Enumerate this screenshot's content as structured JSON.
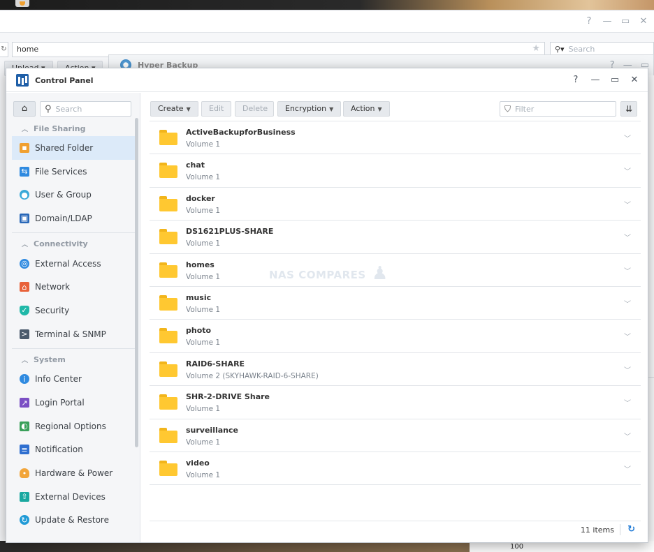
{
  "colors": {
    "accent": "#1f7ad6",
    "active_item_bg": "#dceaf9",
    "folder": "#ffc831"
  },
  "file_station": {
    "path_value": "home",
    "search_placeholder": "Search",
    "upload_label": "Upload",
    "action_label": "Action"
  },
  "hyper_backup": {
    "title": "Hyper Backup"
  },
  "background": {
    "panel_number": "100"
  },
  "control_panel": {
    "title": "Control Panel",
    "help_label": "?",
    "minimize_label": "—",
    "maximize_label": "▭",
    "close_label": "✕"
  },
  "sidebar": {
    "search_placeholder": "Search",
    "groups": [
      {
        "label": "File Sharing",
        "items": [
          {
            "label": "Shared Folder",
            "icon": "shared-folder-icon"
          },
          {
            "label": "File Services",
            "icon": "file-services-icon"
          },
          {
            "label": "User & Group",
            "icon": "user-group-icon"
          },
          {
            "label": "Domain/LDAP",
            "icon": "domain-ldap-icon"
          }
        ]
      },
      {
        "label": "Connectivity",
        "items": [
          {
            "label": "External Access",
            "icon": "external-access-icon"
          },
          {
            "label": "Network",
            "icon": "network-icon"
          },
          {
            "label": "Security",
            "icon": "security-shield-icon"
          },
          {
            "label": "Terminal & SNMP",
            "icon": "terminal-icon"
          }
        ]
      },
      {
        "label": "System",
        "items": [
          {
            "label": "Info Center",
            "icon": "info-center-icon"
          },
          {
            "label": "Login Portal",
            "icon": "login-portal-icon"
          },
          {
            "label": "Regional Options",
            "icon": "regional-options-icon"
          },
          {
            "label": "Notification",
            "icon": "notification-icon"
          },
          {
            "label": "Hardware & Power",
            "icon": "hardware-power-icon"
          },
          {
            "label": "External Devices",
            "icon": "external-devices-icon"
          },
          {
            "label": "Update & Restore",
            "icon": "update-restore-icon"
          }
        ]
      }
    ]
  },
  "toolbar": {
    "create_label": "Create",
    "edit_label": "Edit",
    "delete_label": "Delete",
    "encryption_label": "Encryption",
    "action_label": "Action",
    "filter_placeholder": "Filter"
  },
  "folders": [
    {
      "name": "ActiveBackupforBusiness",
      "volume": "Volume 1"
    },
    {
      "name": "chat",
      "volume": "Volume 1"
    },
    {
      "name": "docker",
      "volume": "Volume 1"
    },
    {
      "name": "DS1621PLUS-SHARE",
      "volume": "Volume 1"
    },
    {
      "name": "homes",
      "volume": "Volume 1"
    },
    {
      "name": "music",
      "volume": "Volume 1"
    },
    {
      "name": "photo",
      "volume": "Volume 1"
    },
    {
      "name": "RAID6-SHARE",
      "volume": "Volume 2 (SKYHAWK-RAID-6-SHARE)"
    },
    {
      "name": "SHR-2-DRIVE Share",
      "volume": "Volume 1"
    },
    {
      "name": "surveillance",
      "volume": "Volume 1"
    },
    {
      "name": "video",
      "volume": "Volume 1"
    }
  ],
  "watermark": "NAS COMPARES",
  "footer": {
    "count_label": "11 items"
  }
}
